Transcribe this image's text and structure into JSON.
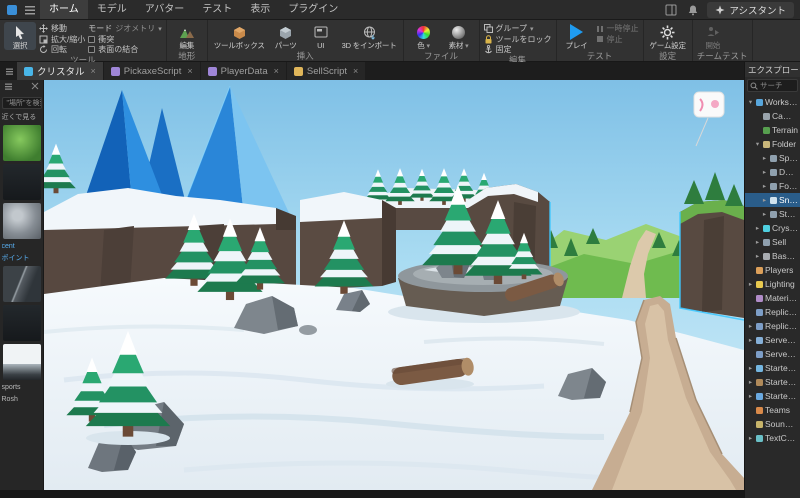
{
  "colors": {
    "accent_blue": "#00a2ff",
    "play_blue": "#1f9bf0",
    "selection_outline_cyan": "#3fc8ff",
    "explorer_selected_row": "#2a5d8a",
    "crystal_blue": "#2e8fe0",
    "snow_white": "#eef3f8",
    "cliff_brown": "#584a41",
    "pine_green": "#1f8455",
    "valley_green": "#6fbb4f",
    "trail_tan": "#c7ad92"
  },
  "icons": {
    "caret": "▾",
    "overflow": "⋯"
  },
  "menu": {
    "items": [
      "ホーム",
      "モデル",
      "アバター",
      "テスト",
      "表示",
      "プラグイン"
    ],
    "active_item": "ホーム",
    "assistant_label": "アシスタント"
  },
  "ribbon": {
    "tools": {
      "label": "ツール",
      "select": "選択",
      "move": "移動",
      "scale": "拡大/縮小",
      "rotate": "回転",
      "mode": "モード",
      "mode_value": "ジオメトリ",
      "collisions": "衝突",
      "join": "表面の結合"
    },
    "terrain": {
      "label": "地形",
      "edit": "編集"
    },
    "insert": {
      "label": "挿入",
      "toolbox": "ツールボックス",
      "parts": "パーツ",
      "ui": "UI",
      "import3d": "3D をインポート"
    },
    "file": {
      "label": "ファイル",
      "color": "色",
      "material": "素材"
    },
    "edit": {
      "label": "編集",
      "group": "グループ",
      "lock": "ツールをロック",
      "anchor": "固定"
    },
    "test": {
      "label": "テスト",
      "play": "プレイ",
      "pause": "一時停止",
      "stop": "停止"
    },
    "settings": {
      "label": "設定",
      "game_settings": "ゲーム設定"
    },
    "team_test": {
      "label": "チームテスト",
      "start": "開始"
    }
  },
  "tabs": [
    {
      "label": "クリスタル",
      "close": "×",
      "active": true
    },
    {
      "label": "PickaxeScript",
      "close": "×",
      "active": false
    },
    {
      "label": "PlayerData",
      "close": "×",
      "active": false
    },
    {
      "label": "SellScript",
      "close": "×",
      "active": false
    }
  ],
  "toolbox": {
    "search_value": "\"場所\"を検索",
    "header": "近くで見る",
    "captions_mid": [
      "cent",
      "ポイント"
    ],
    "captions_bottom": [
      "sports",
      "Rosh"
    ]
  },
  "explorer": {
    "title": "エクスプローラー",
    "search_placeholder": "サーチ",
    "items": [
      {
        "label": "Workspace",
        "arrow": "▾"
      },
      {
        "label": "Camera",
        "arrow": ""
      },
      {
        "label": "Terrain",
        "arrow": ""
      },
      {
        "label": "Folder",
        "arrow": "▾"
      },
      {
        "label": "SpawnLocation",
        "arrow": "▸"
      },
      {
        "label": "Desert",
        "arrow": "▸"
      },
      {
        "label": "Forest",
        "arrow": "▸"
      },
      {
        "label": "Snow",
        "arrow": "▸",
        "selected": true
      },
      {
        "label": "Stone",
        "arrow": "▸"
      },
      {
        "label": "Crystal",
        "arrow": "▸"
      },
      {
        "label": "Sell",
        "arrow": "▸"
      },
      {
        "label": "Baseplate",
        "arrow": "▸"
      },
      {
        "label": "Players",
        "arrow": ""
      },
      {
        "label": "Lighting",
        "arrow": "▸"
      },
      {
        "label": "MaterialService",
        "arrow": ""
      },
      {
        "label": "ReplicatedFirst",
        "arrow": ""
      },
      {
        "label": "ReplicatedStorage",
        "arrow": "▸"
      },
      {
        "label": "ServerScriptService",
        "arrow": "▸"
      },
      {
        "label": "ServerStorage",
        "arrow": ""
      },
      {
        "label": "StarterGui",
        "arrow": "▸"
      },
      {
        "label": "StarterPack",
        "arrow": "▸"
      },
      {
        "label": "StarterPlayer",
        "arrow": "▸"
      },
      {
        "label": "Teams",
        "arrow": ""
      },
      {
        "label": "SoundService",
        "arrow": ""
      },
      {
        "label": "TextChatService",
        "arrow": "▸"
      }
    ]
  }
}
